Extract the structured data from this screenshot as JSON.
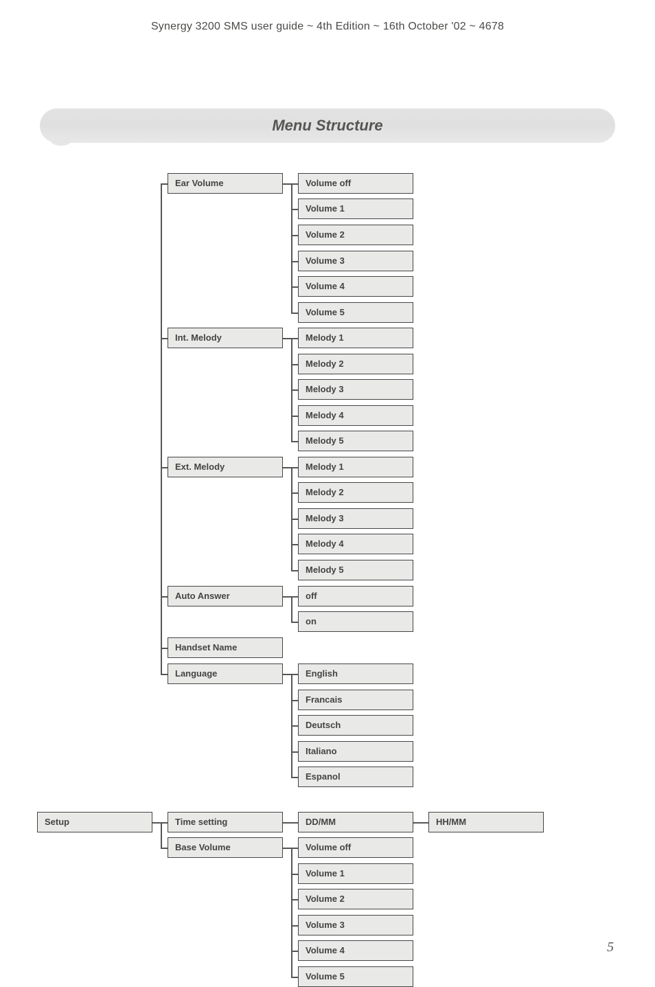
{
  "header": "Synergy 3200 SMS user guide ~ 4th Edition ~ 16th October '02 ~ 4678",
  "title": "Menu Structure",
  "page_number": "5",
  "menu": {
    "col2": {
      "ear_volume": "Ear Volume",
      "int_melody": "Int. Melody",
      "ext_melody": "Ext. Melody",
      "auto_answer": "Auto Answer",
      "handset_name": "Handset Name",
      "language": "Language",
      "time_setting": "Time setting",
      "base_volume": "Base Volume"
    },
    "col1": {
      "setup": "Setup"
    },
    "col3": {
      "ear_volume": [
        "Volume off",
        "Volume 1",
        "Volume 2",
        "Volume 3",
        "Volume 4",
        "Volume 5"
      ],
      "int_melody": [
        "Melody 1",
        "Melody 2",
        "Melody 3",
        "Melody 4",
        "Melody 5"
      ],
      "ext_melody": [
        "Melody 1",
        "Melody 2",
        "Melody 3",
        "Melody 4",
        "Melody 5"
      ],
      "auto_answer": [
        "off",
        "on"
      ],
      "language": [
        "English",
        "Francais",
        "Deutsch",
        "Italiano",
        "Espanol"
      ],
      "time_setting": [
        "DD/MM"
      ],
      "base_volume": [
        "Volume off",
        "Volume 1",
        "Volume 2",
        "Volume 3",
        "Volume 4",
        "Volume 5"
      ]
    },
    "col4": {
      "hhmm": "HH/MM"
    }
  }
}
